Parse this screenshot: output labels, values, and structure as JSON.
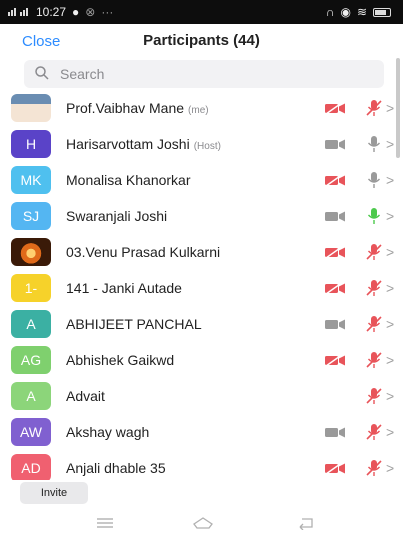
{
  "status_bar": {
    "time": "10:27",
    "left_icons": [
      "signal-icon",
      "signal-icon",
      "notification-dot-icon",
      "sync-icon",
      "more-icon"
    ],
    "right_icons": [
      "headset-icon",
      "eye-icon",
      "wifi-icon",
      "battery-icon"
    ]
  },
  "header": {
    "close_label": "Close",
    "title": "Participants (44)"
  },
  "search": {
    "placeholder": "Search"
  },
  "participants": [
    {
      "name": "Prof.Vaibhav Mane",
      "tag": "(me)",
      "avatar": "",
      "avatar_color": "#7a5a3c",
      "avatar_kind": "photo-person",
      "video": "off",
      "audio": "muted"
    },
    {
      "name": "Harisarvottam Joshi",
      "tag": "(Host)",
      "avatar": "H",
      "avatar_color": "#5a43c8",
      "avatar_kind": "initials",
      "video": "on",
      "audio": "on"
    },
    {
      "name": "Monalisa Khanorkar",
      "tag": "",
      "avatar": "MK",
      "avatar_color": "#4fc0ef",
      "avatar_kind": "initials",
      "video": "off",
      "audio": "on"
    },
    {
      "name": "Swaranjali Joshi",
      "tag": "",
      "avatar": "SJ",
      "avatar_color": "#54b6f2",
      "avatar_kind": "initials",
      "video": "on",
      "audio": "speaking"
    },
    {
      "name": "03.Venu Prasad Kulkarni",
      "tag": "",
      "avatar": "",
      "avatar_color": "#e06a1a",
      "avatar_kind": "photo-orange",
      "video": "off",
      "audio": "muted"
    },
    {
      "name": "141 - Janki Autade",
      "tag": "",
      "avatar": "1-",
      "avatar_color": "#f6d22a",
      "avatar_kind": "initials",
      "video": "off",
      "audio": "muted"
    },
    {
      "name": "ABHIJEET   PANCHAL",
      "tag": "",
      "avatar": "A",
      "avatar_color": "#3bb0a3",
      "avatar_kind": "initials",
      "video": "on",
      "audio": "muted"
    },
    {
      "name": "Abhishek Gaikwd",
      "tag": "",
      "avatar": "AG",
      "avatar_color": "#7fd06e",
      "avatar_kind": "initials",
      "video": "off",
      "audio": "muted"
    },
    {
      "name": "Advait",
      "tag": "",
      "avatar": "A",
      "avatar_color": "#8cd57a",
      "avatar_kind": "initials",
      "video": "none",
      "audio": "muted"
    },
    {
      "name": "Akshay wagh",
      "tag": "",
      "avatar": "AW",
      "avatar_color": "#8060d0",
      "avatar_kind": "initials",
      "video": "on",
      "audio": "muted"
    },
    {
      "name": "Anjali dhable 35",
      "tag": "",
      "avatar": "AD",
      "avatar_color": "#f06070",
      "avatar_kind": "initials",
      "video": "off",
      "audio": "muted"
    }
  ],
  "colors": {
    "accent": "#2d8cff",
    "muted_red": "#e8545a",
    "icon_grey": "#9a9a9a",
    "speaking_green": "#4cc94c"
  },
  "invite_label": "Invite",
  "navbar": {
    "icons": [
      "menu-icon",
      "home-icon",
      "back-icon"
    ]
  }
}
